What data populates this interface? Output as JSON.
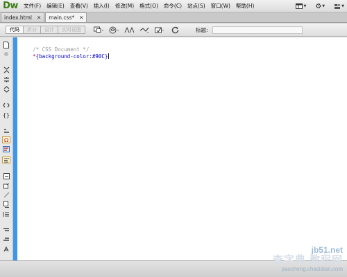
{
  "app": {
    "logo": "Dw"
  },
  "menu": [
    {
      "label": "文件(F)"
    },
    {
      "label": "编辑(E)"
    },
    {
      "label": "查看(V)"
    },
    {
      "label": "插入(I)"
    },
    {
      "label": "修改(M)"
    },
    {
      "label": "格式(O)"
    },
    {
      "label": "命令(C)"
    },
    {
      "label": "站点(S)"
    },
    {
      "label": "窗口(W)"
    },
    {
      "label": "帮助(H)"
    }
  ],
  "menu_right": [
    {
      "icon": "layout-icon"
    },
    {
      "icon": "gear-icon"
    },
    {
      "icon": "extend-icon"
    }
  ],
  "tabs": [
    {
      "label": "index.html",
      "active": false
    },
    {
      "label": "main.css*",
      "active": true
    }
  ],
  "toolbar": {
    "views": [
      {
        "label": "代码",
        "active": true
      },
      {
        "label": "拆分",
        "active": false
      },
      {
        "label": "设计",
        "active": false
      },
      {
        "label": "实时视图",
        "active": false
      }
    ],
    "title_label": "标题:",
    "title_value": ""
  },
  "editor": {
    "lines": [
      {
        "parts": [
          {
            "text": "/* CSS Document */",
            "cls": "c-comment"
          }
        ]
      },
      {
        "parts": [
          {
            "text": "*",
            "cls": "c-sel"
          },
          {
            "text": "{background-color:#90C}",
            "cls": "c-prop"
          }
        ]
      }
    ],
    "accent_color": "#3f96e6"
  },
  "watermark": {
    "site": "jb51.net",
    "brand": "查字典 教程网",
    "url": "jiaocheng.chazidian.com"
  }
}
